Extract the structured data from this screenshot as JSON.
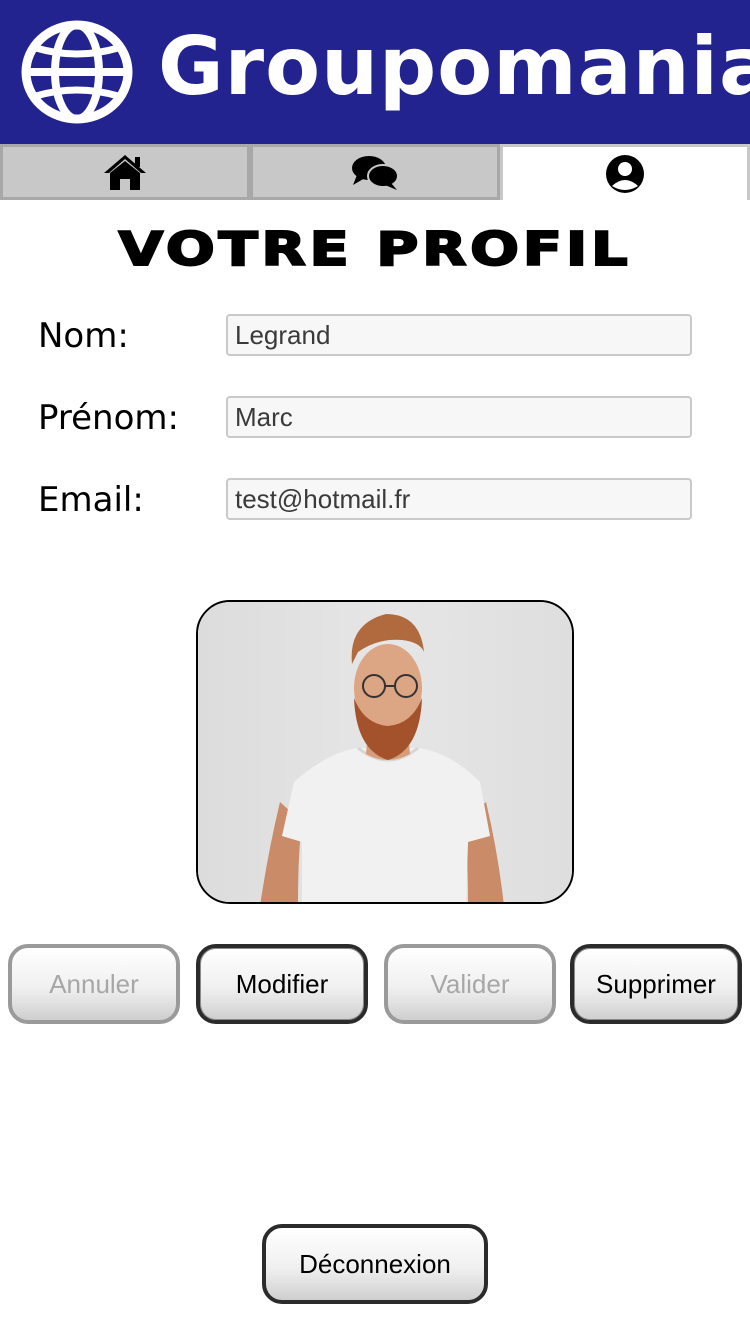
{
  "header": {
    "brand": "Groupomania",
    "logo_icon": "globe-icon",
    "background_color": "#22238f"
  },
  "nav": {
    "tabs": [
      {
        "icon": "home-icon",
        "active": false
      },
      {
        "icon": "chat-bubbles-icon",
        "active": false
      },
      {
        "icon": "user-circle-icon",
        "active": true
      }
    ]
  },
  "page": {
    "title": "VOTRE PROFIL"
  },
  "form": {
    "nom_label": "Nom:",
    "nom_value": "Legrand",
    "prenom_label": "Prénom:",
    "prenom_value": "Marc",
    "email_label": "Email:",
    "email_value": "test@hotmail.fr"
  },
  "actions": {
    "annuler": "Annuler",
    "modifier": "Modifier",
    "valider": "Valider",
    "supprimer": "Supprimer",
    "deconnexion": "Déconnexion"
  }
}
